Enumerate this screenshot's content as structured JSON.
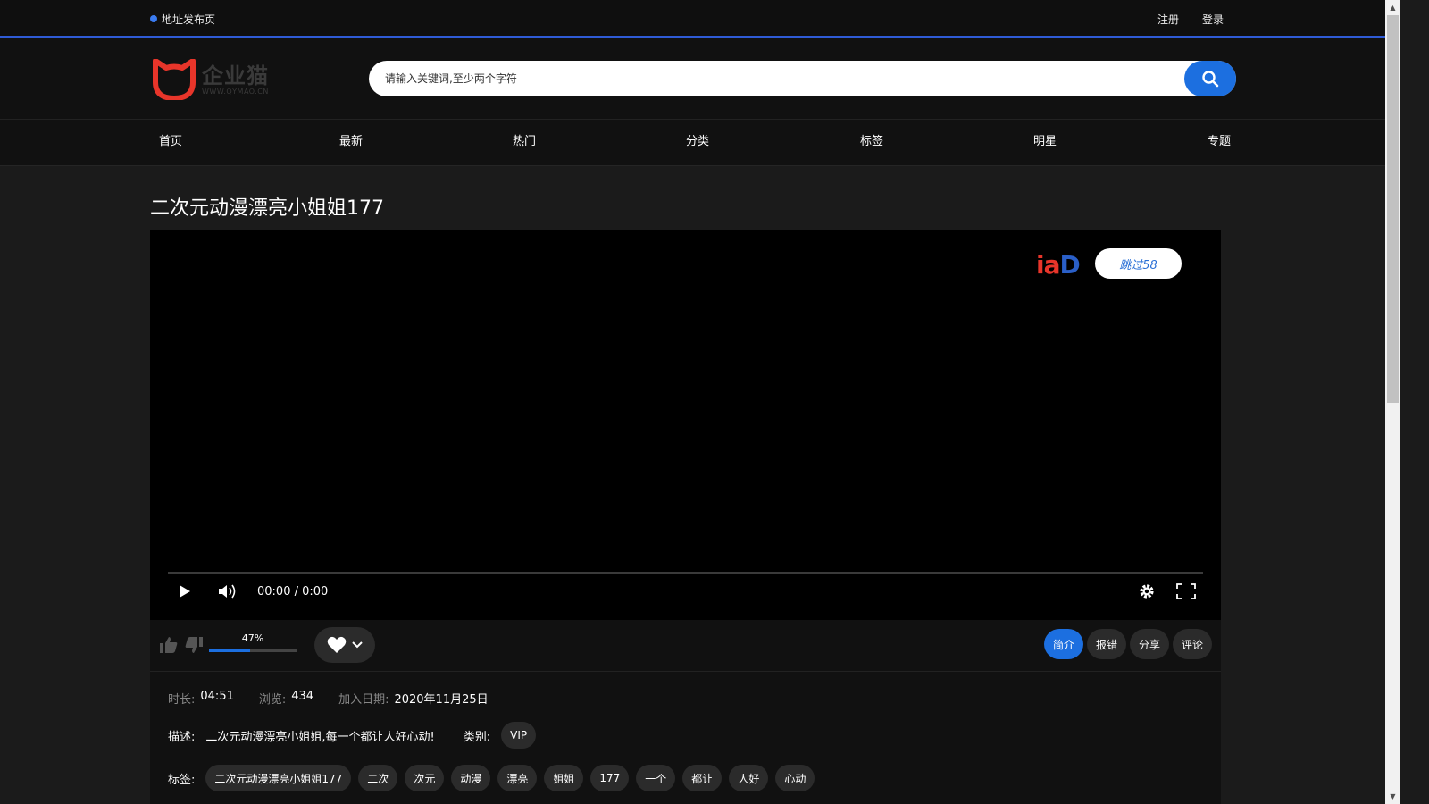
{
  "topbar": {
    "announce": "地址发布页",
    "register": "注册",
    "login": "登录"
  },
  "logo": {
    "name": "企业猫",
    "url": "WWW.QYMAO.CN"
  },
  "search": {
    "placeholder": "请输入关键词,至少两个字符"
  },
  "nav": [
    "首页",
    "最新",
    "热门",
    "分类",
    "标签",
    "明星",
    "专题"
  ],
  "video": {
    "title": "二次元动漫漂亮小姐姐177",
    "ad_brand": "iaD",
    "skip_label": "跳过58",
    "time": "00:00 / 0:00"
  },
  "actions": {
    "rating_pct": "47%",
    "rating_value": 0.47,
    "tabs": [
      {
        "label": "简介",
        "active": true
      },
      {
        "label": "报错",
        "active": false
      },
      {
        "label": "分享",
        "active": false
      },
      {
        "label": "评论",
        "active": false
      }
    ]
  },
  "info": {
    "duration_label": "时长:",
    "duration": "04:51",
    "views_label": "浏览:",
    "views": "434",
    "date_label": "加入日期:",
    "date": "2020年11月25日",
    "desc_label": "描述:",
    "desc": "二次元动漫漂亮小姐姐,每一个都让人好心动!",
    "category_label": "类别:",
    "category": "VIP",
    "tags_label": "标签:",
    "tags": [
      "二次元动漫漂亮小姐姐177",
      "二次",
      "次元",
      "动漫",
      "漂亮",
      "姐姐",
      "177",
      "一个",
      "都让",
      "人好",
      "心动"
    ]
  },
  "colors": {
    "accent": "#1c6fe0",
    "topbar_border": "#2f5bd6",
    "logo_red": "#e8352a"
  }
}
